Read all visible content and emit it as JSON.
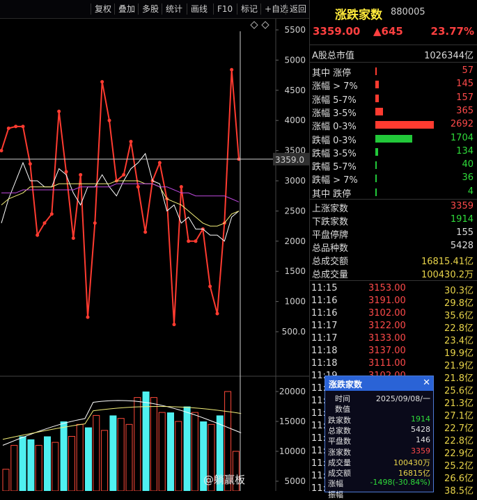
{
  "toolbar": {
    "items": [
      "复权",
      "叠加",
      "多股",
      "统计",
      "画线",
      "F10",
      "标记",
      "+自选",
      "返回"
    ]
  },
  "main_chart": {
    "y_ticks": [
      "5500",
      "5000",
      "4500",
      "4000",
      "3500",
      "3000",
      "2500",
      "2000",
      "1500",
      "1000",
      "500.0"
    ],
    "cursor_value": "3359.0",
    "line_colors": {
      "red": "#ff3b30",
      "white": "#ffffff",
      "yellow": "#f4f07a",
      "purple": "#c04ae0"
    }
  },
  "volume_chart": {
    "y_ticks": [
      "20000",
      "15000",
      "10000",
      "5000"
    ]
  },
  "chart_data": {
    "type": "line",
    "x": [
      1,
      2,
      3,
      4,
      5,
      6,
      7,
      8,
      9,
      10,
      11,
      12,
      13,
      14,
      15,
      16,
      17,
      18,
      19,
      20,
      21,
      22,
      23,
      24,
      25,
      26,
      27,
      28,
      29,
      30,
      31,
      32,
      33,
      34,
      35,
      36,
      37,
      38,
      39,
      40,
      41,
      42,
      43,
      44,
      45
    ],
    "series": [
      {
        "name": "",
        "color": "#ff3b30",
        "values": [
          3500,
          3870,
          3900,
          3900,
          3280,
          2100,
          2300,
          2450,
          4150,
          3150,
          2050,
          3100,
          740,
          2300,
          4640,
          4000,
          3000,
          3100,
          3650,
          2900,
          2150,
          3000,
          3300,
          2700,
          620,
          2900,
          2000,
          2000,
          2200,
          1250,
          800,
          2300,
          4840,
          3359,
          null,
          null,
          null,
          null,
          null,
          null,
          null,
          null,
          null,
          null,
          null
        ]
      },
      {
        "name": "",
        "color": "#ffffff",
        "values": [
          2300,
          2700,
          3000,
          3300,
          3000,
          3000,
          2900,
          2900,
          3200,
          3100,
          2800,
          2600,
          2900,
          2900,
          3100,
          2900,
          2750,
          3000,
          3200,
          3300,
          3450,
          3000,
          2950,
          2500,
          2600,
          2300,
          2400,
          2200,
          2200,
          2100,
          2100,
          2000,
          2400,
          2500,
          null,
          null,
          null,
          null,
          null,
          null,
          null,
          null,
          null,
          null,
          null
        ]
      },
      {
        "name": "",
        "color": "#f4f07a",
        "values": [
          2600,
          2700,
          2750,
          2800,
          2900,
          2900,
          2900,
          2900,
          2950,
          2950,
          2950,
          2950,
          2950,
          2950,
          2950,
          2950,
          3000,
          3000,
          3000,
          3000,
          2950,
          2950,
          2900,
          2700,
          2650,
          2600,
          2500,
          2400,
          2300,
          2250,
          2250,
          2300,
          2450,
          2500,
          null,
          null,
          null,
          null,
          null,
          null,
          null,
          null,
          null,
          null,
          null
        ]
      },
      {
        "name": "",
        "color": "#c04ae0",
        "values": [
          2800,
          2800,
          2800,
          2850,
          2850,
          2850,
          2850,
          2850,
          2850,
          2850,
          2850,
          2900,
          2900,
          2900,
          2900,
          2900,
          2950,
          2950,
          2950,
          2950,
          2950,
          2950,
          2900,
          2900,
          2850,
          2800,
          2800,
          2750,
          2750,
          2750,
          2750,
          2750,
          2700,
          2650,
          null,
          null,
          null,
          null,
          null,
          null,
          null,
          null,
          null,
          null,
          null
        ]
      }
    ],
    "ylim": [
      300,
      5600
    ],
    "volume": {
      "cyan_bars": [
        {
          "x": 3,
          "v": 12500
        },
        {
          "x": 4,
          "v": 12000
        },
        {
          "x": 6,
          "v": 12500
        },
        {
          "x": 8,
          "v": 15000
        },
        {
          "x": 11,
          "v": 14000
        },
        {
          "x": 14,
          "v": 16000
        },
        {
          "x": 18,
          "v": 20000
        },
        {
          "x": 21,
          "v": 16500
        },
        {
          "x": 23,
          "v": 17500
        },
        {
          "x": 25,
          "v": 15000
        },
        {
          "x": 27,
          "v": 16000
        }
      ],
      "red_bars": [
        {
          "x": 1,
          "v": 7000
        },
        {
          "x": 2,
          "v": 11000
        },
        {
          "x": 5,
          "v": 11000
        },
        {
          "x": 7,
          "v": 11500
        },
        {
          "x": 9,
          "v": 12500
        },
        {
          "x": 10,
          "v": 14500
        },
        {
          "x": 12,
          "v": 16000
        },
        {
          "x": 13,
          "v": 13500
        },
        {
          "x": 15,
          "v": 15500
        },
        {
          "x": 16,
          "v": 14500
        },
        {
          "x": 17,
          "v": 19000
        },
        {
          "x": 19,
          "v": 19000
        },
        {
          "x": 20,
          "v": 16500
        },
        {
          "x": 22,
          "v": 15000
        },
        {
          "x": 24,
          "v": 16500
        },
        {
          "x": 26,
          "v": 14500
        },
        {
          "x": 28,
          "v": 20000
        },
        {
          "x": 29,
          "v": 10000
        }
      ],
      "ylim": [
        3000,
        21000
      ]
    }
  },
  "panel": {
    "title": "涨跌家数",
    "code": "880005",
    "price": "3359.00",
    "change": "▲645",
    "pct": "23.77%",
    "market_cap_label": "A股总市值",
    "market_cap_value": "1026344亿",
    "distribution": [
      {
        "label": "其中 涨停",
        "value": "57",
        "bar": 57,
        "dir": "up"
      },
      {
        "label": "涨幅 > 7%",
        "value": "145",
        "bar": 145,
        "dir": "up"
      },
      {
        "label": "涨幅 5-7%",
        "value": "157",
        "bar": 157,
        "dir": "up"
      },
      {
        "label": "涨幅 3-5%",
        "value": "365",
        "bar": 365,
        "dir": "up"
      },
      {
        "label": "涨幅 0-3%",
        "value": "2692",
        "bar": 2692,
        "dir": "up"
      },
      {
        "label": "跌幅 0-3%",
        "value": "1704",
        "bar": 1704,
        "dir": "down"
      },
      {
        "label": "跌幅 3-5%",
        "value": "134",
        "bar": 134,
        "dir": "down"
      },
      {
        "label": "跌幅 5-7%",
        "value": "40",
        "bar": 40,
        "dir": "down"
      },
      {
        "label": "跌幅 > 7%",
        "value": "36",
        "bar": 36,
        "dir": "down"
      },
      {
        "label": "其中 跌停",
        "value": "4",
        "bar": 4,
        "dir": "down"
      }
    ],
    "stats": [
      {
        "label": "上涨家数",
        "value": "3359",
        "color": "#ff4a4a"
      },
      {
        "label": "下跌家数",
        "value": "1914",
        "color": "#2fdc3a"
      },
      {
        "label": "平盘停牌",
        "value": "155",
        "color": "#dddddd"
      },
      {
        "label": "总品种数",
        "value": "5428",
        "color": "#dddddd"
      },
      {
        "label": "总成交额",
        "value": "16815.41亿",
        "color": "#e8d44a"
      },
      {
        "label": "总成交量",
        "value": "100430.2万",
        "color": "#e8d44a"
      }
    ],
    "ticks": [
      {
        "t": "11:15",
        "p": "3153.00",
        "v": "30.3亿"
      },
      {
        "t": "11:16",
        "p": "3191.00",
        "v": "29.8亿"
      },
      {
        "t": "11:16",
        "p": "3102.00",
        "v": "35.6亿"
      },
      {
        "t": "11:17",
        "p": "3122.00",
        "v": "22.8亿"
      },
      {
        "t": "11:17",
        "p": "3133.00",
        "v": "23.4亿"
      },
      {
        "t": "11:18",
        "p": "3137.00",
        "v": "19.9亿"
      },
      {
        "t": "11:18",
        "p": "3111.00",
        "v": "21.9亿"
      },
      {
        "t": "11:19",
        "p": "3102.00",
        "v": "21.8亿"
      },
      {
        "t": "11:19",
        "p": "",
        "v": "25.6亿"
      },
      {
        "t": "11:20",
        "p": "",
        "v": "21.3亿"
      },
      {
        "t": "11:20",
        "p": "",
        "v": "27.1亿"
      },
      {
        "t": "11:21",
        "p": "",
        "v": "22.7亿"
      },
      {
        "t": "11:21",
        "p": "",
        "v": "22.8亿"
      },
      {
        "t": "11:22",
        "p": "",
        "v": "22.9亿"
      },
      {
        "t": "11:22",
        "p": "",
        "v": "25.2亿"
      },
      {
        "t": "11:23",
        "p": "",
        "v": "26.6亿"
      },
      {
        "t": "11:23",
        "p": "",
        "v": "38.5亿"
      }
    ]
  },
  "popup": {
    "title": "涨跌家数",
    "close": "✕",
    "rows": [
      {
        "label": "时间",
        "value": "2025/09/08/一",
        "color": "#e0e0e0"
      },
      {
        "label": "数值",
        "value": "",
        "color": "#e0e0e0"
      },
      {
        "label": "跌家数",
        "value": "1914",
        "color": "#2fdc3a"
      },
      {
        "label": "总家数",
        "value": "5428",
        "color": "#e0e0e0"
      },
      {
        "label": "平盘数",
        "value": "146",
        "color": "#e0e0e0"
      },
      {
        "label": "涨家数",
        "value": "3359",
        "color": "#ff4a4a"
      },
      {
        "label": "成交量",
        "value": "100430万",
        "color": "#e8d44a"
      },
      {
        "label": "成交额",
        "value": "16815亿",
        "color": "#e8d44a"
      },
      {
        "label": "涨幅",
        "value": "-1498(-30.84%)",
        "color": "#2fdc3a"
      },
      {
        "label": "振幅",
        "value": "",
        "color": "#e0e0e0"
      }
    ]
  },
  "watermark": "@躺赢板"
}
